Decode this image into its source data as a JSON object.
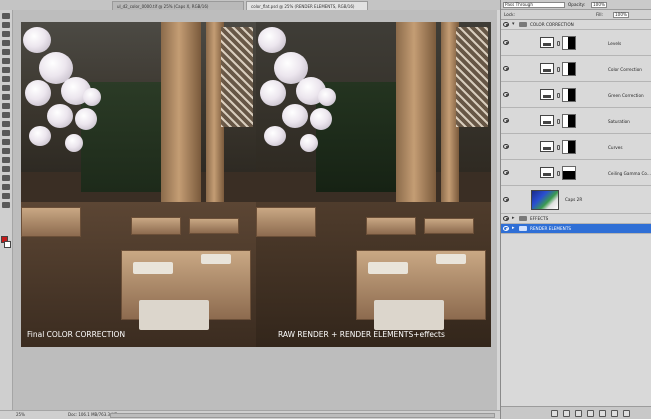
{
  "tabs": [
    {
      "label": "ul_d2_color_0000.tif @ 25% (Caps X, RGB/16)",
      "active": false
    },
    {
      "label": "color_flat.psd @ 25% (RENDER ELEMENTS, RGB/16)",
      "active": true
    }
  ],
  "tool_colors": {
    "foreground": "#c41a1a",
    "background": "#ffffff"
  },
  "tool_icons": [
    "move-icon",
    "marquee-icon",
    "lasso-icon",
    "quick-select-icon",
    "crop-icon",
    "eyedropper-icon",
    "healing-brush-icon",
    "brush-icon",
    "clone-stamp-icon",
    "history-brush-icon",
    "eraser-icon",
    "gradient-icon",
    "blur-icon",
    "dodge-icon",
    "pen-icon",
    "type-icon",
    "path-select-icon",
    "shape-icon",
    "3d-rotate-icon",
    "3d-orbit-icon",
    "hand-icon",
    "zoom-icon"
  ],
  "canvas": {
    "left_caption": "Final COLOR CORRECTION",
    "right_caption": "RAW RENDER + RENDER ELEMENTS+effects"
  },
  "status_bar": {
    "zoom": "25%",
    "doc_info": "Doc: 106.1 MB/763.3 MB"
  },
  "layers_panel": {
    "blend_mode": "Pass Through",
    "opacity_label": "Opacity:",
    "opacity_value": "100%",
    "lock_label": "Lock:",
    "fill_label": "Fill:",
    "fill_value": "100%",
    "layers": [
      {
        "name": "COLOR CORRECTION",
        "kind": "group-open"
      },
      {
        "name": "Levels",
        "kind": "adjustment"
      },
      {
        "name": "Color Correction",
        "kind": "adjustment"
      },
      {
        "name": "Green Correction",
        "kind": "adjustment"
      },
      {
        "name": "Saturation",
        "kind": "adjustment"
      },
      {
        "name": "Curves",
        "kind": "adjustment"
      },
      {
        "name": "Ceiling Gamma Co...",
        "kind": "adjustment"
      },
      {
        "name": "Caps 2R",
        "kind": "image"
      },
      {
        "name": "EFFECTS",
        "kind": "group"
      },
      {
        "name": "RENDER ELEMENTS",
        "kind": "group-selected"
      }
    ],
    "bottom_icons": [
      "link-layers-icon",
      "fx-icon",
      "add-mask-icon",
      "new-adjustment-icon",
      "new-group-icon",
      "new-layer-icon",
      "delete-layer-icon"
    ]
  }
}
